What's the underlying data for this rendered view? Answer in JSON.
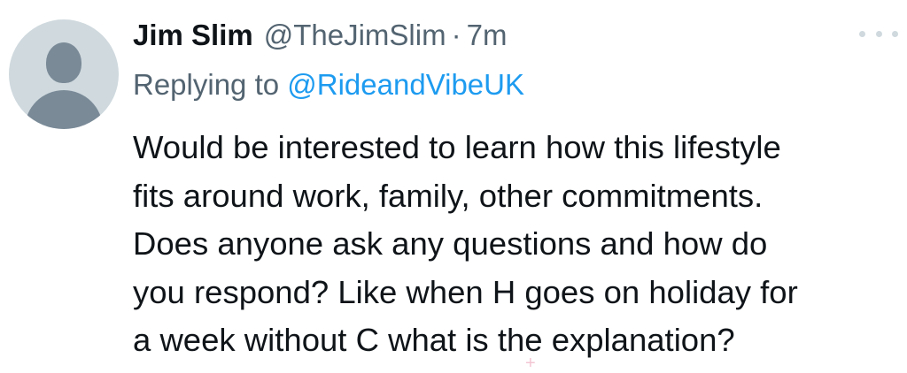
{
  "tweet": {
    "display_name": "Jim Slim",
    "handle": "@TheJimSlim",
    "separator": "·",
    "time": "7m",
    "replying_prefix": "Replying to ",
    "replying_to": "@RideandVibeUK",
    "body_lines": [
      "Would be interested to learn how this lifestyle",
      "fits around work, family, other commitments.",
      "Does anyone ask any questions and how do",
      "you respond? Like when H goes on holiday for",
      "a week without C what is the explanation?"
    ],
    "more_icon": "more-horizontal-icon",
    "avatar_icon": "default-avatar-icon"
  },
  "colors": {
    "text_primary": "#0f1419",
    "text_secondary": "#536471",
    "link": "#1d9bf0",
    "avatar_bg": "#cfd9de",
    "avatar_fg": "#7a8a97"
  }
}
